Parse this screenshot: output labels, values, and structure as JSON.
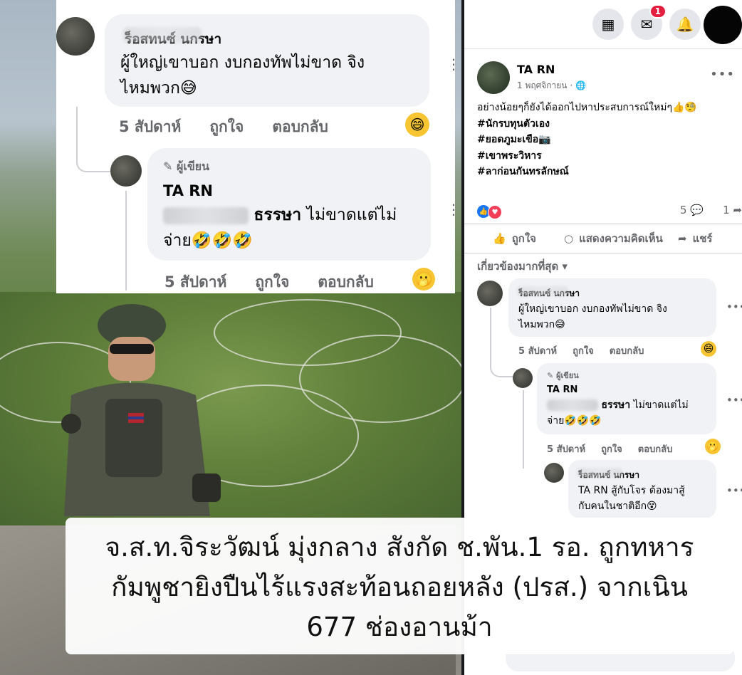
{
  "left_snippet": {
    "comment1": {
      "name": "ร็อสทนซ์ นกรษา",
      "text_line1": "ผู้ใหญ่เขาบอก งบกองทัพไม่ขาด จิง",
      "text_line2": "ไหมพวก😅",
      "time": "5 สัปดาห์",
      "like": "ถูกใจ",
      "reply": "ตอบกลับ",
      "reaction_emoji": "😄"
    },
    "comment2": {
      "author_badge": "ผู้เขียน",
      "name": "TA RN",
      "mention_tail": "ธรรษา",
      "text_tail": "ไม่ขาดแต่ไม่",
      "text_line2": "จ่าย🤣🤣🤣",
      "time": "5 สัปดาห์",
      "like": "ถูกใจ",
      "reply": "ตอบกลับ",
      "reaction_emoji": "🫢"
    }
  },
  "caption": {
    "line1": "จ.ส.ท.จิระวัฒน์ มุ่งกลาง สังกัด ช.พัน.1 รอ. ถูกทหาร",
    "line2": "กัมพูชายิงปืนไร้แรงสะท้อนถอยหลัง (ปรส.) จากเนิน",
    "line3": "677 ช่องอานม้า"
  },
  "facebook": {
    "topbar": {
      "menu_icon": "grid-menu-icon",
      "messenger_icon": "messenger-icon",
      "messenger_badge": "1",
      "notifications_icon": "bell-icon"
    },
    "post": {
      "author": "TA RN",
      "time": "1 พฤศจิกายน ·",
      "privacy_icon": "globe-icon",
      "text": "อย่างน้อยๆก็ยังได้ออกไปหาประสบการณ์ใหม่ๆ👍🧐",
      "hashtags": [
        "#นักรบทุนตัวเอง",
        "#ยอดภูมะเขือ📷",
        "#เขาพระวิหาร",
        "#ลาก่อนกันทรลักษณ์"
      ],
      "comment_count": "5",
      "share_count": "1",
      "actions": {
        "like": "ถูกใจ",
        "comment": "แสดงความคิดเห็น",
        "share": "แชร์"
      },
      "sort_label": "เกี่ยวข้องมากที่สุด"
    },
    "comments": [
      {
        "name": "ร็อสทนซ์ นกรษา",
        "line1": "ผู้ใหญ่เขาบอก งบกองทัพไม่ขาด จิง",
        "line2": "ไหมพวก😅",
        "time": "5 สัปดาห์",
        "like": "ถูกใจ",
        "reply": "ตอบกลับ",
        "reaction_emoji": "😄"
      },
      {
        "author_badge": "ผู้เขียน",
        "name": "TA RN",
        "mention_tail": "ธรรษา",
        "text_tail": "ไม่ขาดแต่ไม่",
        "line2": "จ่าย🤣🤣🤣",
        "time": "5 สัปดาห์",
        "like": "ถูกใจ",
        "reply": "ตอบกลับ",
        "reaction_emoji": "🫢"
      },
      {
        "name": "ร็อสทนซ์ นกรษา",
        "line1": "TA RN สู้กับโจร ต้องมาสู้",
        "line2": "กับคนในชาติอีก😵"
      }
    ]
  }
}
